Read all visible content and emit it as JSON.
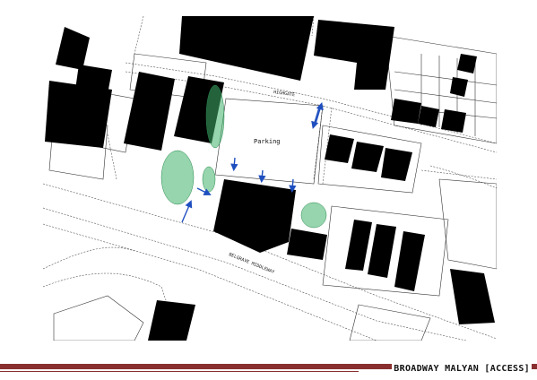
{
  "labels": {
    "parking": "Parking",
    "street_top": "HIGHGATE",
    "street_main": "BELGRAVE MIDDLEWAY"
  },
  "footer": {
    "title": "BROADWAY MALYAN [ACCESS]"
  },
  "colors": {
    "building": "#000000",
    "tree": "#3fb36b",
    "arrow": "#1f4fbf",
    "footer_bar": "#8a2f2f",
    "line": "#444444"
  }
}
